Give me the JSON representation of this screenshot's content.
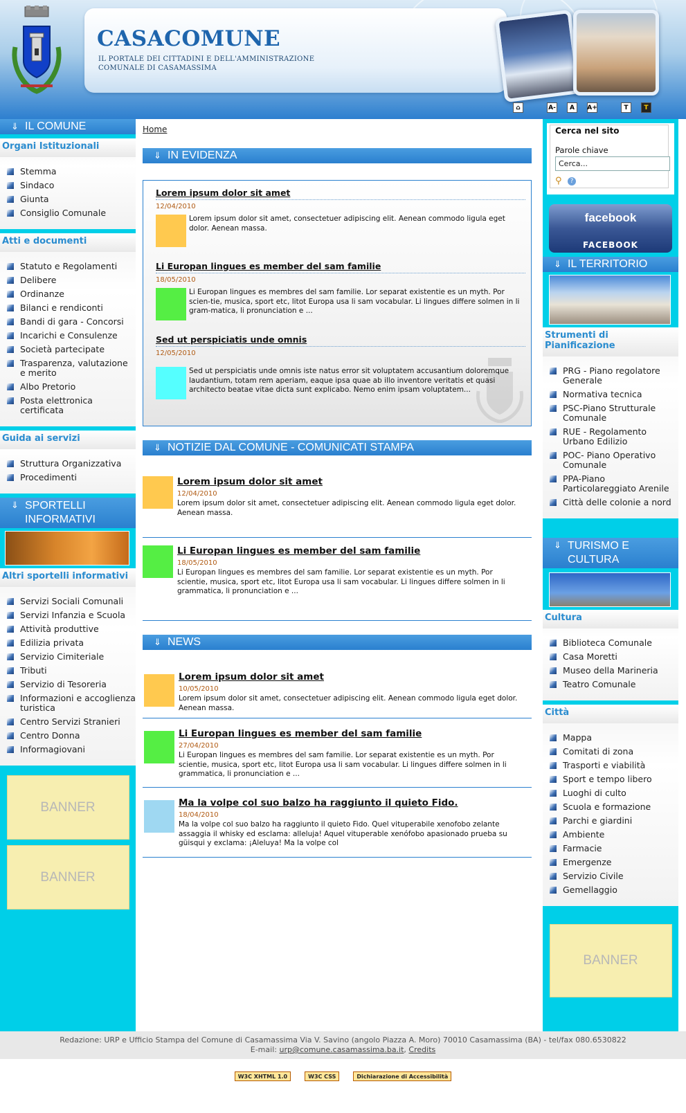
{
  "header": {
    "site_name": "CASACOMUNE",
    "site_subtitle_1": "IL PORTALE DEI CITTADINI E DELL'AMMINISTRAZIONE",
    "site_subtitle_2": "COMUNALE DI CASAMASSIMA",
    "toolbar": [
      "home-icon",
      "A-",
      "A",
      "A+",
      "T",
      "T"
    ]
  },
  "left": {
    "il_comune": "IL COMUNE",
    "organi": {
      "title": "Organi Istituzionali",
      "items": [
        "Stemma",
        "Sindaco",
        "Giunta",
        "Consiglio Comunale"
      ]
    },
    "atti": {
      "title": "Atti e documenti",
      "items": [
        "Statuto e Regolamenti",
        "Delibere",
        "Ordinanze",
        "Bilanci e rendiconti",
        "Bandi di gara - Concorsi",
        "Incarichi e Consulenze",
        "Società partecipate",
        "Trasparenza, valutazione e merito",
        "Albo Pretorio",
        "Posta elettronica certificata"
      ]
    },
    "guida": {
      "title": "Guida ai servizi",
      "items": [
        "Struttura Organizzativa",
        "Procedimenti"
      ]
    },
    "sportelli": "SPORTELLI INFORMATIVI",
    "altri": {
      "title": "Altri sportelli informativi",
      "items": [
        "Servizi Sociali Comunali",
        "Servizi Infanzia e Scuola",
        "Attività produttive",
        "Edilizia privata",
        "Servizio Cimiteriale",
        "Tributi",
        "Servizio di Tesoreria",
        "Informazioni e accoglienza turistica",
        "Centro Servizi Stranieri",
        "Centro Donna",
        "Informagiovani"
      ]
    },
    "banner1": "BANNER",
    "banner2": "BANNER"
  },
  "center": {
    "breadcrumb": "Home",
    "evidenza_title": "IN EVIDENZA",
    "evidenza": [
      {
        "title": "Lorem ipsum dolor sit amet",
        "date": "12/04/2010",
        "text": "Lorem ipsum dolor sit amet, consectetuer adipiscing elit. Aenean commodo ligula eget dolor. Aenean massa.",
        "color": "#ffc94f"
      },
      {
        "title": "Li Europan lingues es member del sam familie",
        "date": "18/05/2010",
        "text": "Li Europan lingues es membres del sam familie. Lor separat existentie es un myth. Por scien-tie, musica, sport etc, litot Europa usa li sam vocabular. Li lingues differe solmen in li gram-matica, li pronunciation e ...",
        "color": "#55ee44"
      },
      {
        "title": "Sed ut perspiciatis unde omnis",
        "date": "12/05/2010",
        "text": "Sed ut perspiciatis unde omnis iste natus error sit voluptatem accusantium doloremque laudantium, totam rem aperiam, eaque ipsa quae ab illo inventore veritatis et quasi architecto beatae vitae dicta sunt explicabo. Nemo enim ipsam voluptatem...",
        "color": "#55ffff"
      }
    ],
    "notizie_title": "NOTIZIE DAL COMUNE - COMUNICATI STAMPA",
    "notizie": [
      {
        "title": "Lorem ipsum dolor sit amet",
        "date": "12/04/2010",
        "text": "Lorem ipsum dolor sit amet, consectetuer adipiscing elit. Aenean commodo ligula eget dolor. Aenean massa.",
        "color": "#ffc94f"
      },
      {
        "title": "Li Europan lingues es member del sam familie",
        "date": "18/05/2010",
        "text": "Li Europan lingues es membres del sam familie. Lor separat existentie es un myth. Por scientie, musica, sport etc, litot Europa usa li sam vocabular. Li lingues differe solmen in li grammatica, li pronunciation e ...",
        "color": "#55ee44"
      }
    ],
    "news_title": "NEWS",
    "news": [
      {
        "title": "Lorem ipsum dolor sit amet",
        "date": "10/05/2010",
        "text": "Lorem ipsum dolor sit amet, consectetuer adipiscing elit. Aenean commodo ligula eget dolor. Aenean massa.",
        "color": "#ffc94f"
      },
      {
        "title": "Li Europan lingues es member del sam familie",
        "date": "27/04/2010",
        "text": "Li Europan lingues es membres del sam familie. Lor separat existentie es un myth. Por scientie, musica, sport etc, litot Europa usa li sam vocabular. Li lingues differe solmen in li grammatica, li pronunciation e ...",
        "color": "#55ee44"
      },
      {
        "title": "Ma la volpe col suo balzo ha raggiunto il quieto Fido.",
        "date": "18/04/2010",
        "text": "Ma la volpe col suo balzo ha raggiunto il quieto Fido. Quel vituperabile xenofobo zelante assaggia il whisky ed esclama: alleluja! Aquel vituperable xenófobo apasionado prueba su güisqui y exclama: ¡Aleluya! Ma la volpe col",
        "color": "#9fd8f2"
      }
    ]
  },
  "right": {
    "search": {
      "legend": "Cerca nel sito",
      "label": "Parole chiave",
      "value": "Cerca..."
    },
    "facebook_logo": "facebook",
    "facebook_caption": "FACEBOOK",
    "territorio": "IL TERRITORIO",
    "strumenti": {
      "title": "Strumenti di Pianificazione",
      "items": [
        "PRG - Piano regolatore Generale",
        "Normativa tecnica",
        "PSC-Piano Strutturale Comunale",
        "RUE - Regolamento Urbano Edilizio",
        "POC- Piano Operativo Comunale",
        "PPA-Piano Particolareggiato Arenile",
        "Città delle colonie a nord"
      ]
    },
    "turismo": "TURISMO E CULTURA",
    "cultura": {
      "title": "Cultura",
      "items": [
        "Biblioteca Comunale",
        "Casa Moretti",
        "Museo della Marineria",
        "Teatro Comunale"
      ]
    },
    "citta": {
      "title": "Città",
      "items": [
        "Mappa",
        "Comitati di zona",
        "Trasporti e viabilità",
        "Sport e tempo libero",
        "Luoghi di culto",
        "Scuola e formazione",
        "Parchi e giardini",
        "Ambiente",
        "Farmacie",
        "Emergenze",
        "Servizio Civile",
        "Gemellaggio"
      ]
    },
    "banner": "BANNER"
  },
  "footer": {
    "line1": "Redazione: URP e Ufficio Stampa del Comune di Casamassima Via V. Savino (angolo Piazza A. Moro)  70010 Casamassima (BA) - tel/fax 080.6530822",
    "email_prefix": "E-mail:",
    "email": "urp@comune.casamassima.ba.it",
    "credits": "Credits",
    "badge_xhtml": "W3C XHTML 1.0",
    "badge_css": "W3C CSS",
    "badge_access": "Dichiarazione di Accessibilità"
  }
}
